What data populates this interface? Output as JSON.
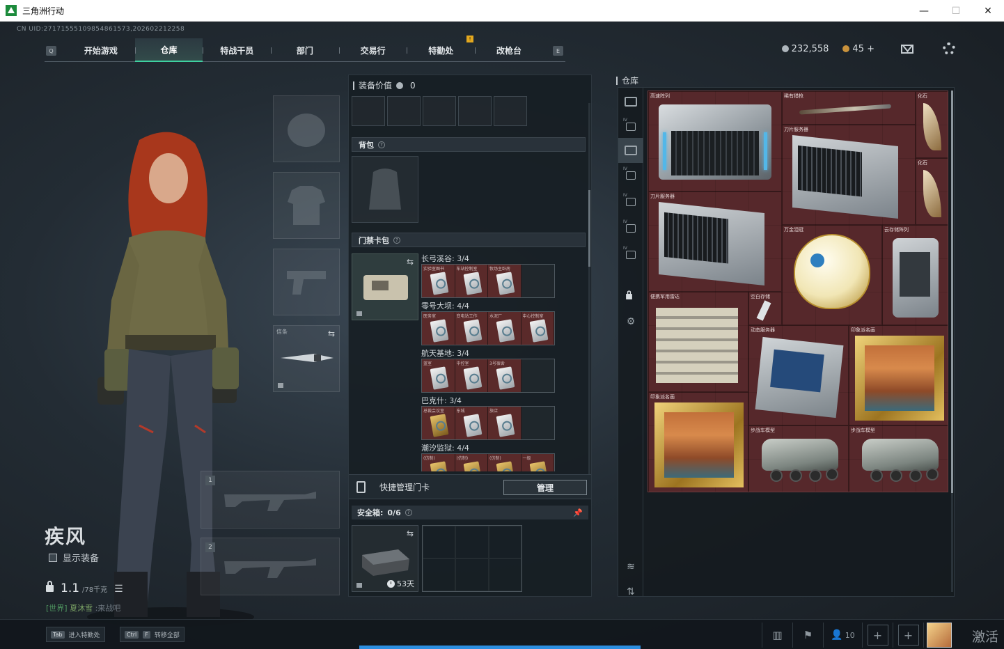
{
  "window": {
    "title": "三角洲行动",
    "controls": {
      "minimize": "—",
      "maximize": "☐",
      "close": "✕"
    }
  },
  "uid_text": "CN UID:27171555109854861573,202602212258",
  "nav": {
    "left_key": "Q",
    "right_key": "E",
    "items": [
      "开始游戏",
      "仓库",
      "特战干员",
      "部门",
      "交易行",
      "特勤处",
      "改枪台"
    ],
    "active_index": 1,
    "badge": "!"
  },
  "currency": {
    "silver": "232,558",
    "gold": "45 +"
  },
  "character": {
    "name": "疾风",
    "show_equip_label": "显示装备",
    "weight_value": "1.1",
    "weight_max": "/78千克",
    "chat_channel": "[世界]",
    "chat_user": "夏沐雪",
    "chat_text": ":来战吧"
  },
  "equipment": {
    "melee_label": "信条",
    "gun_slots": [
      "1",
      "2"
    ]
  },
  "center": {
    "value_label": "装备价值",
    "value_amount": "0",
    "backpack_label": "背包",
    "keycard_label": "门禁卡包",
    "qmark": "?",
    "key_groups": [
      {
        "label": "长弓溪谷: 3/4",
        "cards": [
          "实验室图书",
          "车站控制室",
          "牧场主卧房"
        ],
        "slots": 4
      },
      {
        "label": "零号大坝: 4/4",
        "cards": [
          "医务室",
          "变电站工作",
          "水泥厂",
          "中心控制室"
        ],
        "slots": 4
      },
      {
        "label": "航天基地: 3/4",
        "cards": [
          "蓝室",
          "中控室",
          "3号宿舍"
        ],
        "slots": 4
      },
      {
        "label": "巴克什: 3/4",
        "cards": [
          "总裁会议室",
          "东城",
          "旅店"
        ],
        "slots": 4
      },
      {
        "label": "潮汐监狱: 4/4",
        "cards": [
          "(仿制)",
          "(仿制)",
          "(仿制)",
          "一级"
        ],
        "slots": 4
      }
    ],
    "quick_manage_label": "快捷管理门卡",
    "manage_button": "管理",
    "safe_label": "安全箱:",
    "safe_count": "0/6",
    "safe_timer": "53天"
  },
  "warehouse": {
    "title": "仓库",
    "sidebar_tabs": [
      "IV",
      "IV",
      "IV",
      "IV",
      "IV"
    ],
    "items": [
      {
        "name": "高速阵列"
      },
      {
        "name": "稀有猎枪"
      },
      {
        "name": "化石"
      },
      {
        "name": "刀片服务器"
      },
      {
        "name": "化石"
      },
      {
        "name": "刀片服务器"
      },
      {
        "name": "万金泪冠"
      },
      {
        "name": "云存储阵列"
      },
      {
        "name": "便携军用雷达"
      },
      {
        "name": "空白存储"
      },
      {
        "name": "动态服务器"
      },
      {
        "name": "印象派名画"
      },
      {
        "name": "印象派名画"
      },
      {
        "name": "步战车模型"
      },
      {
        "name": "步战车模型"
      }
    ]
  },
  "bottom": {
    "hint1_key": "Tab",
    "hint1_text": "进入特勤处",
    "hint2_key1": "Ctrl",
    "hint2_key2": "F",
    "hint2_text": "转移全部",
    "friends_count": "10",
    "activate_text": "激活"
  },
  "colors": {
    "accent": "#3ed1a0",
    "warehouse_bg": "#4a2326",
    "progress": "#2c8ee0"
  }
}
